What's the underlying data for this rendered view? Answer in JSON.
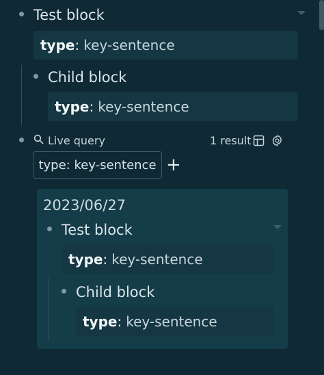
{
  "blocks": {
    "parent_title": "Test block",
    "child_title": "Child block",
    "prop_key": "type",
    "prop_colon": ":",
    "prop_value": "key-sentence"
  },
  "live_query": {
    "label": "Live query",
    "result_count": "1 result",
    "filter": "type: key-sentence",
    "add_symbol": "+"
  },
  "result": {
    "date": "2023/06/27",
    "parent_title": "Test block",
    "child_title": "Child block",
    "prop_key": "type",
    "prop_colon": ":",
    "prop_value": "key-sentence"
  },
  "icons": [
    "search-icon",
    "table-icon",
    "gear-icon",
    "chevron-down-icon"
  ],
  "colors": {
    "background": "#0f2a35",
    "property_bg": "#143743",
    "result_card_bg": "#143c49",
    "bullet": "#7f98a2"
  }
}
